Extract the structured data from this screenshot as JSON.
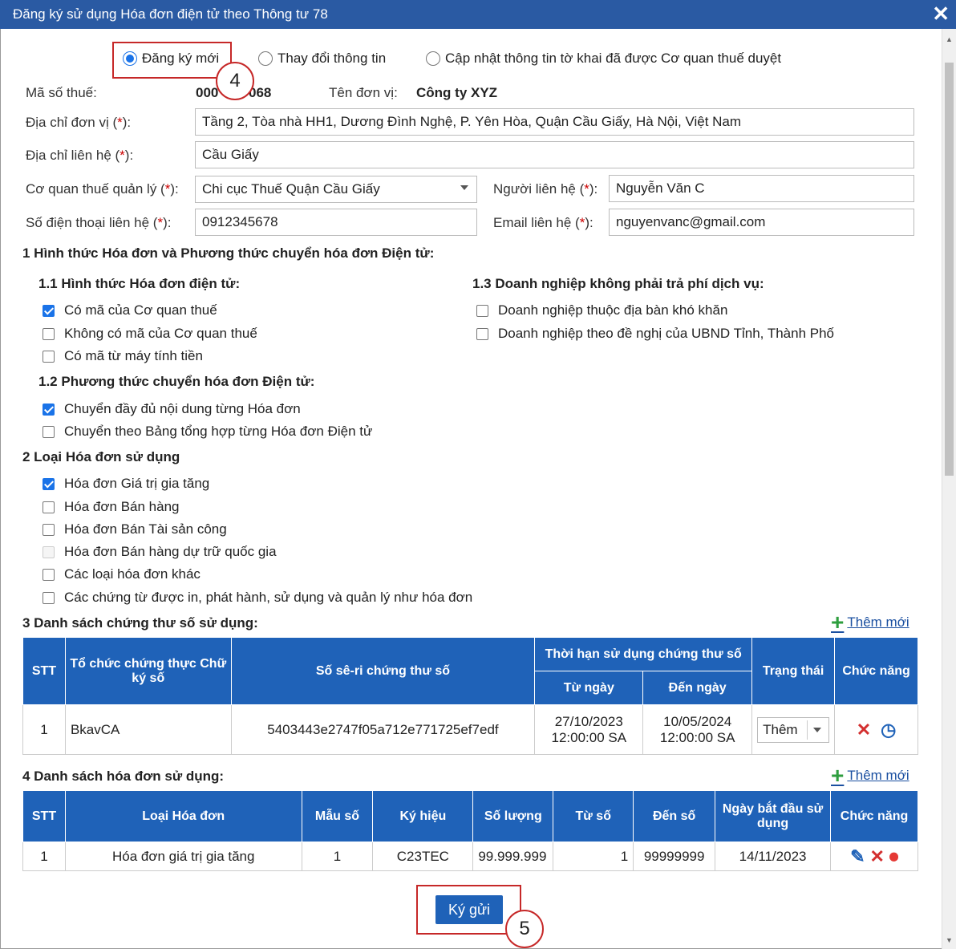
{
  "window": {
    "title": "Đăng ký sử dụng Hóa đơn điện tử theo Thông tư 78",
    "close_glyph": "✕"
  },
  "registration_type": {
    "options": [
      "Đăng ký mới",
      "Thay đổi thông tin",
      "Cập nhật thông tin tờ khai đã được Cơ quan thuế duyệt"
    ],
    "selected": "Đăng ký mới"
  },
  "form": {
    "tax_code_label": "Mã số thuế:",
    "tax_code_value": "000",
    "tax_code_value_tail": "068",
    "unit_name_label": "Tên đơn vị:",
    "unit_name_value": "Công ty XYZ",
    "address_label": "Địa chỉ đơn vị (",
    "address_value": "Tầng 2, Tòa nhà HH1, Dương Đình Nghệ, P. Yên Hòa, Quận Cầu Giấy, Hà Nội, Việt Nam",
    "contact_address_label": "Địa chỉ liên hệ (",
    "contact_address_value": "Cầu Giấy",
    "tax_office_label": "Cơ quan thuế quản lý (",
    "tax_office_value": "Chi cục Thuế Quận Cầu Giấy",
    "contact_person_label": "Người liên hệ (",
    "contact_person_value": "Nguyễn Văn C",
    "phone_label": "Số điện thoại liên hệ (",
    "phone_value": "0912345678",
    "email_label": "Email liên hệ (",
    "email_value": "nguyenvanc@gmail.com",
    "req_mark": "*",
    "label_close": "):"
  },
  "section1": {
    "title": "1 Hình thức Hóa đơn và Phương thức chuyển hóa đơn Điện tử:",
    "s11": {
      "title": "1.1 Hình thức Hóa đơn điện tử:",
      "items": [
        {
          "label": "Có mã của Cơ quan thuế",
          "checked": true
        },
        {
          "label": "Không có mã của Cơ quan thuế",
          "checked": false
        },
        {
          "label": "Có mã từ máy tính tiền",
          "checked": false
        }
      ]
    },
    "s12": {
      "title": "1.2 Phương thức chuyển hóa đơn Điện tử:",
      "items": [
        {
          "label": "Chuyển đầy đủ nội dung từng Hóa đơn",
          "checked": true
        },
        {
          "label": "Chuyển theo Bảng tổng hợp từng Hóa đơn Điện tử",
          "checked": false
        }
      ]
    },
    "s13": {
      "title": "1.3 Doanh nghiệp không phải trả phí dịch vụ:",
      "items": [
        {
          "label": "Doanh nghiệp thuộc địa bàn khó khăn",
          "checked": false
        },
        {
          "label": "Doanh nghiệp theo đề nghị của UBND Tỉnh, Thành Phố",
          "checked": false
        }
      ]
    }
  },
  "section2": {
    "title": "2 Loại Hóa đơn sử dụng",
    "items": [
      {
        "label": "Hóa đơn Giá trị gia tăng",
        "checked": true
      },
      {
        "label": "Hóa đơn Bán hàng",
        "checked": false
      },
      {
        "label": "Hóa đơn Bán Tài sản công",
        "checked": false
      },
      {
        "label": "Hóa đơn Bán hàng dự trữ quốc gia",
        "checked": false,
        "disabled": true
      },
      {
        "label": "Các loại hóa đơn khác",
        "checked": false
      },
      {
        "label": "Các chứng từ được in, phát hành, sử dụng và quản lý như hóa đơn",
        "checked": false
      }
    ]
  },
  "section3": {
    "title": "3 Danh sách chứng thư số sử dụng:",
    "add_label": "Thêm mới",
    "headers": {
      "stt": "STT",
      "org": "Tổ chức chứng thực Chữ ký số",
      "serial": "Số sê-ri chứng thư số",
      "validity": "Thời hạn sử dụng chứng thư số",
      "from": "Từ ngày",
      "to": "Đến ngày",
      "status": "Trạng thái",
      "func": "Chức năng"
    },
    "rows": [
      {
        "stt": "1",
        "org": "BkavCA",
        "serial": "5403443e2747f05a712e771725ef7edf",
        "from_date": "27/10/2023",
        "from_time": "12:00:00 SA",
        "to_date": "10/05/2024",
        "to_time": "12:00:00 SA",
        "status": "Thêm"
      }
    ]
  },
  "section4": {
    "title": "4 Danh sách hóa đơn sử dụng:",
    "add_label": "Thêm mới",
    "headers": {
      "stt": "STT",
      "type": "Loại Hóa đơn",
      "template": "Mẫu số",
      "symbol": "Ký hiệu",
      "qty": "Số lượng",
      "from": "Từ số",
      "to": "Đến số",
      "start": "Ngày bắt đầu sử dụng",
      "func": "Chức năng"
    },
    "rows": [
      {
        "stt": "1",
        "type": "Hóa đơn giá trị gia tăng",
        "template": "1",
        "symbol": "C23TEC",
        "qty": "99.999.999",
        "from": "1",
        "to": "99999999",
        "start": "14/11/2023"
      }
    ]
  },
  "submit_label": "Ký gửi",
  "annotations": {
    "step4": "4",
    "step5": "5"
  },
  "colors": {
    "header_bg": "#2a5aa3",
    "table_header": "#1f62b8",
    "accent": "#1a73e8",
    "danger": "#c62828",
    "add_green": "#2e9e3e"
  },
  "icons": {
    "delete": "✕",
    "history": "◷",
    "edit": "✎",
    "stop": "⏺"
  }
}
